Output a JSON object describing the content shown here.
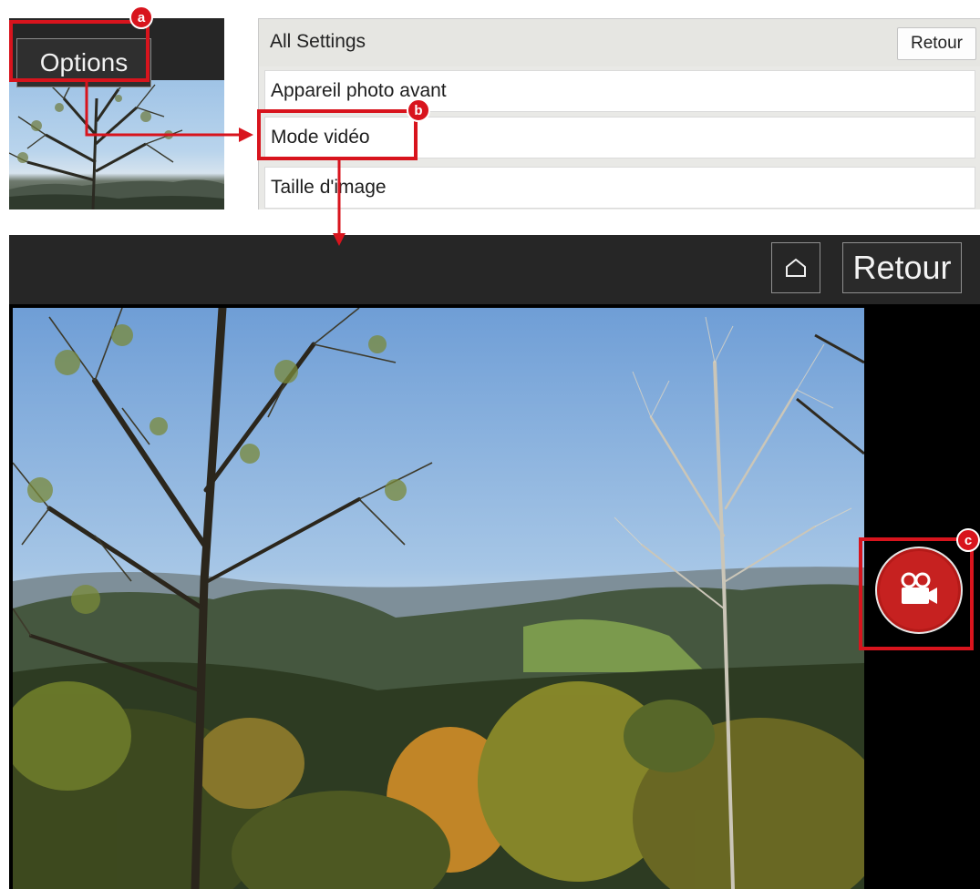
{
  "panel_a": {
    "options_label": "Options"
  },
  "settings": {
    "title": "All Settings",
    "back_label": "Retour",
    "items": [
      {
        "label": "Appareil photo avant"
      },
      {
        "label": "Mode vidéo"
      },
      {
        "label": "Taille d'image"
      }
    ]
  },
  "camera": {
    "back_label": "Retour",
    "home_icon": "home-icon",
    "record_icon": "video-camera-icon"
  },
  "annotations": {
    "a": "a",
    "b": "b",
    "c": "c"
  },
  "colors": {
    "highlight": "#d8141d",
    "record": "#c62120",
    "bar": "#262626"
  }
}
